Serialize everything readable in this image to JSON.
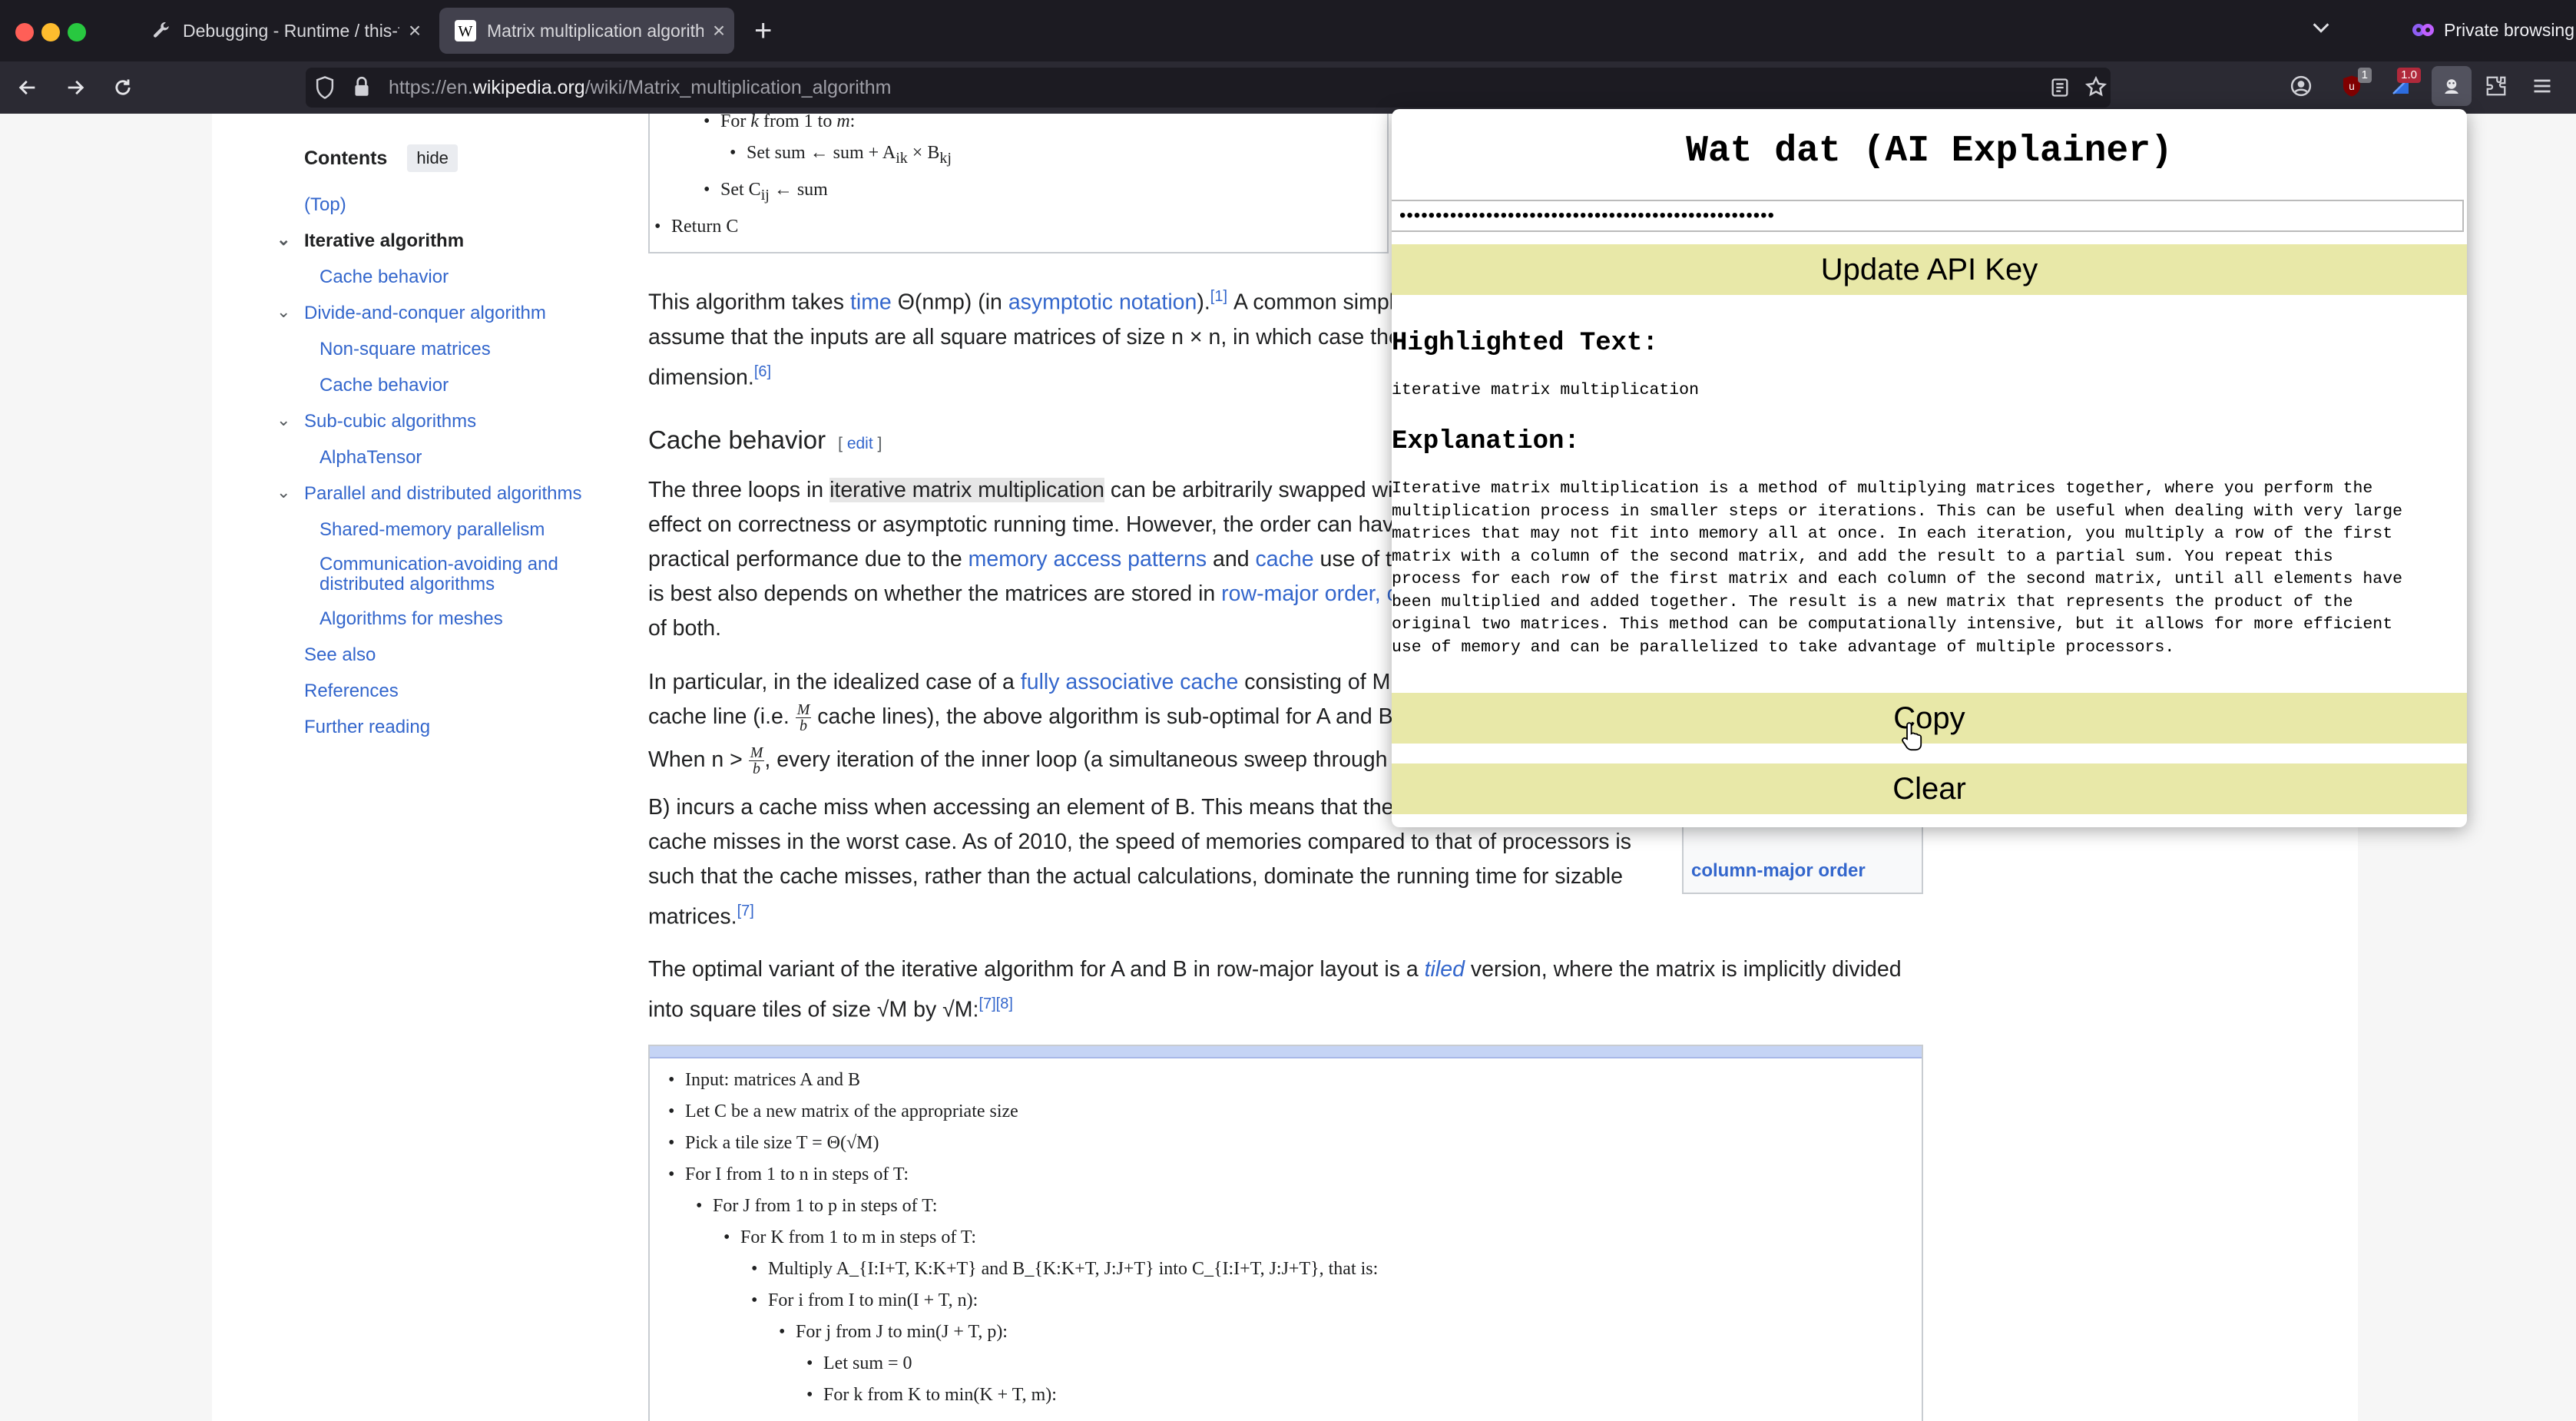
{
  "tabs": [
    {
      "label": "Debugging - Runtime / this-firef",
      "icon": "wrench-icon",
      "active": false
    },
    {
      "label": "Matrix multiplication algorithm -",
      "icon": "wikipedia-icon",
      "active": true
    }
  ],
  "private_label": "Private browsing",
  "url": {
    "prefix": "https://en.",
    "domain": "wikipedia.org",
    "path": "/wiki/Matrix_multiplication_algorithm"
  },
  "toolbar_badges": {
    "ublock": "1",
    "ext2": "1.0"
  },
  "toc": {
    "title": "Contents",
    "hide": "hide",
    "items": [
      {
        "label": "(Top)"
      },
      {
        "label": "Iterative algorithm"
      },
      {
        "label": "Cache behavior"
      },
      {
        "label": "Divide-and-conquer algorithm"
      },
      {
        "label": "Non-square matrices"
      },
      {
        "label": "Cache behavior"
      },
      {
        "label": "Sub-cubic algorithms"
      },
      {
        "label": "AlphaTensor"
      },
      {
        "label": "Parallel and distributed algorithms"
      },
      {
        "label": "Shared-memory parallelism"
      },
      {
        "label": "Communication-avoiding and distributed algorithms"
      },
      {
        "label": "Algorithms for meshes"
      },
      {
        "label": "See also"
      },
      {
        "label": "References"
      },
      {
        "label": "Further reading"
      }
    ]
  },
  "article": {
    "algo_top": {
      "line1": "For k from 1 to m:",
      "line2": "Set sum ← sum + A",
      "line2_sub1": "ik",
      "line2_mid": " × B",
      "line2_sub2": "kj",
      "line3a": "Set C",
      "line3_sub": "ij",
      "line3b": " ← sum",
      "line4": "Return C"
    },
    "p1": {
      "a": "This algorithm takes ",
      "time": "time",
      "b": " Θ(nmp) (in ",
      "asym": "asymptotic notation",
      "c": ").",
      "ref1": "[1]",
      "d": " A common simpl",
      "e": "assume that the inputs are all square matrices of size n × n, in which case the",
      "f": "dimension.",
      "ref6": "[6]"
    },
    "h_cache": "Cache behavior",
    "edit": "edit",
    "p2": {
      "l1a": "The three loops in ",
      "l1hl": "iterative matrix multiplication",
      "l1b": " can be arbitrarily swapped wit",
      "l2": "effect on correctness or asymptotic running time. However, the order can have",
      "l3a": "practical performance due to the ",
      "l3link1": "memory access patterns",
      "l3b": " and ",
      "l3link2": "cache",
      "l3c": " use of th",
      "l4a": "is best also depends on whether the matrices are stored in ",
      "l4link": "row-major order, co",
      "l5": "of both."
    },
    "p3": {
      "l1a": "In particular, in the idealized case of a ",
      "l1link": "fully associative cache",
      "l1b": " consisting of M l",
      "l2a": "cache line (i.e. ",
      "frac_num": "M",
      "frac_den": "b",
      "l2b": " cache lines), the above algorithm is sub-optimal for A and B",
      "l3a": "When n > ",
      "l3b": ", every iteration of the inner loop (a simultaneous sweep through",
      "l4": "B) incurs a cache miss when accessing an element of B. This means that the",
      "l5": "cache misses in the worst case. As of 2010, the speed of memories compared to that of processors is",
      "l6": "such that the cache misses, rather than the actual calculations, dominate the running time for sizable",
      "l7": "matrices.",
      "ref7": "[7]"
    },
    "p4": {
      "l1a": "The optimal variant of the iterative algorithm for A and B in row-major layout is a ",
      "l1link": "tiled",
      "l1b": " version, where the matrix is implicitly divided",
      "l2": "into square tiles of size √M by √M:",
      "refs": "[7][8]"
    },
    "infobox_link": "column-major order",
    "algo_tiled": [
      "Input: matrices A and B",
      "Let C be a new matrix of the appropriate size",
      "Pick a tile size T = Θ(√M)",
      "For I from 1 to n in steps of T:",
      "For J from 1 to p in steps of T:",
      "For K from 1 to m in steps of T:",
      "Multiply A_{I:I+T, K:K+T} and B_{K:K+T, J:J+T} into C_{I:I+T, J:J+T}, that is:",
      "For i from I to min(I + T, n):",
      "For j from J to min(J + T, p):",
      "Let sum = 0",
      "For k from K to min(K + T, m):"
    ]
  },
  "popup": {
    "title": "Wat dat (AI Explainer)",
    "api_key_value": "••••••••••••••••••••••••••••••••••••••••••••••••••••",
    "update_label": "Update API Key",
    "highlighted_heading": "Highlighted Text:",
    "highlighted_text": "iterative matrix multiplication",
    "explanation_heading": "Explanation:",
    "explanation_lines": [
      "Iterative matrix multiplication is a method of multiplying matrices together, where you perform the",
      "multiplication process in smaller steps or iterations. This can be useful when dealing with very large",
      "matrices that may not fit into memory all at once. In each iteration, you multiply a row of the first",
      "matrix with a column of the second matrix, and add the result to a partial sum. You repeat this",
      "process for each row of the first matrix and each column of the second matrix, until all elements have",
      "been multiplied and added together. The result is a new matrix that represents the product of the",
      "original two matrices. This method can be computationally intensive, but it allows for more efficient",
      "use of memory and can be parallelized to take advantage of multiple processors."
    ],
    "copy_label": "Copy",
    "clear_label": "Clear"
  },
  "colors": {
    "link": "#3366cc",
    "popup_button": "#e8e8a8",
    "chrome_bg": "#1c1b22"
  }
}
